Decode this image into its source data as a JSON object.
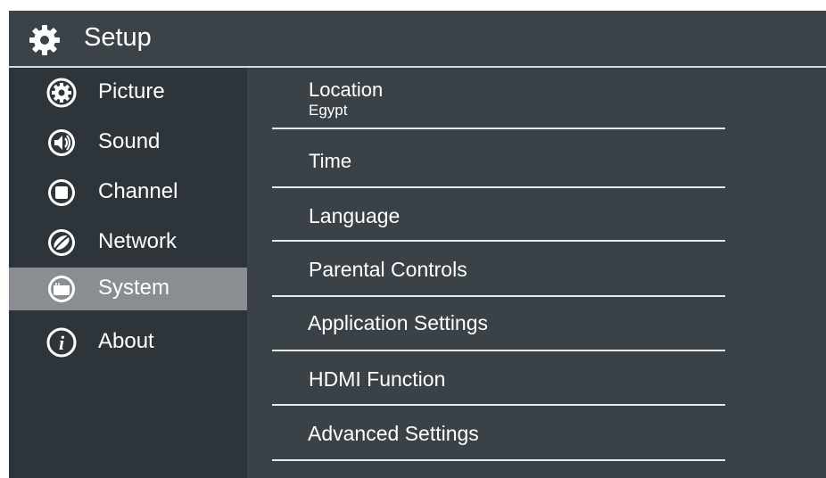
{
  "header": {
    "title": "Setup",
    "icon": "gear-icon"
  },
  "sidebar": {
    "items": [
      {
        "label": "Picture",
        "icon": "picture-icon",
        "selected": false
      },
      {
        "label": "Sound",
        "icon": "speaker-icon",
        "selected": false
      },
      {
        "label": "Channel",
        "icon": "channel-icon",
        "selected": false
      },
      {
        "label": "Network",
        "icon": "network-icon",
        "selected": false
      },
      {
        "label": "System",
        "icon": "system-icon",
        "selected": true
      },
      {
        "label": "About",
        "icon": "info-icon",
        "selected": false
      }
    ]
  },
  "menu": {
    "items": [
      {
        "label": "Location",
        "value": "Egypt"
      },
      {
        "label": "Time"
      },
      {
        "label": "Language"
      },
      {
        "label": "Parental Controls"
      },
      {
        "label": "Application Settings"
      },
      {
        "label": "HDMI Function"
      },
      {
        "label": "Advanced Settings"
      }
    ]
  },
  "colors": {
    "background": "#3a4248",
    "sidebar": "#2e353a",
    "selected": "#8a8e92",
    "text": "#ffffff"
  }
}
